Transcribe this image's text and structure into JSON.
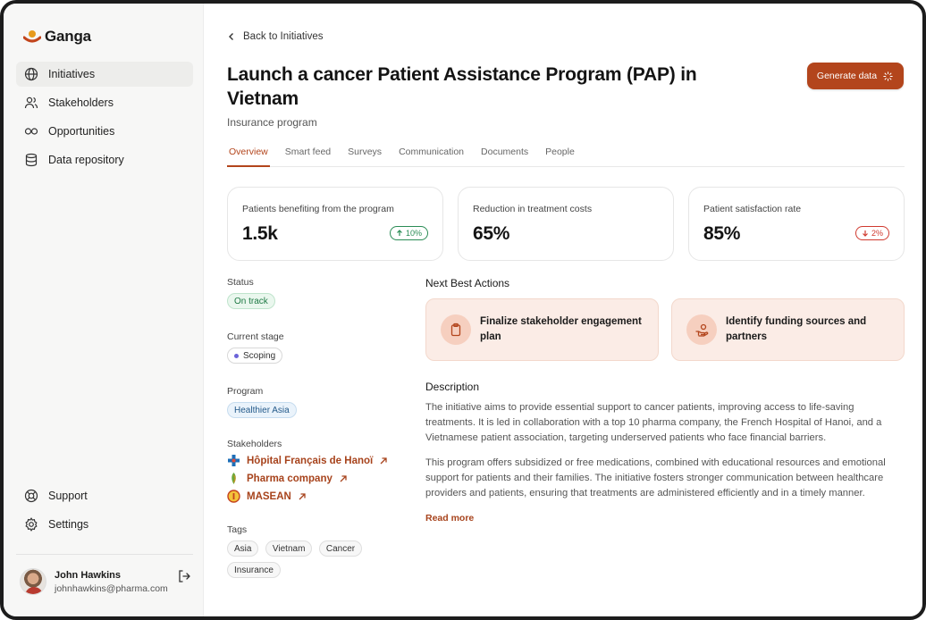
{
  "app": {
    "name": "Ganga",
    "accent": "#b3451c"
  },
  "sidebar": {
    "items": [
      {
        "label": "Initiatives",
        "icon": "globe-icon",
        "active": true
      },
      {
        "label": "Stakeholders",
        "icon": "users-icon"
      },
      {
        "label": "Opportunities",
        "icon": "infinity-icon"
      },
      {
        "label": "Data repository",
        "icon": "database-icon"
      }
    ],
    "bottom_items": [
      {
        "label": "Support",
        "icon": "lifebuoy-icon"
      },
      {
        "label": "Settings",
        "icon": "gear-icon"
      }
    ],
    "user": {
      "name": "John Hawkins",
      "email": "johnhawkins@pharma.com"
    }
  },
  "header": {
    "back_label": "Back to Initiatives",
    "title": "Launch a cancer Patient Assistance Program (PAP) in Vietnam",
    "subtitle": "Insurance program",
    "generate_label": "Generate data"
  },
  "tabs": [
    {
      "label": "Overview",
      "active": true
    },
    {
      "label": "Smart feed"
    },
    {
      "label": "Surveys"
    },
    {
      "label": "Communication"
    },
    {
      "label": "Documents"
    },
    {
      "label": "People"
    }
  ],
  "stats": [
    {
      "label": "Patients benefiting from the program",
      "value": "1.5k",
      "trend": "10%",
      "direction": "up"
    },
    {
      "label": "Reduction in treatment costs",
      "value": "65%"
    },
    {
      "label": "Patient satisfaction rate",
      "value": "85%",
      "trend": "2%",
      "direction": "down"
    }
  ],
  "meta": {
    "status_label": "Status",
    "status_value": "On track",
    "stage_label": "Current stage",
    "stage_value": "Scoping",
    "program_label": "Program",
    "program_value": "Healthier Asia",
    "stakeholders_label": "Stakeholders",
    "stakeholders": [
      {
        "name": "Hôpital Français de Hanoï"
      },
      {
        "name": "Pharma company"
      },
      {
        "name": "MASEAN"
      }
    ],
    "tags_label": "Tags",
    "tags": [
      "Asia",
      "Vietnam",
      "Cancer",
      "Insurance"
    ]
  },
  "next_best_actions": {
    "title": "Next Best Actions",
    "items": [
      {
        "label": "Finalize stakeholder engagement plan",
        "icon": "clipboard-icon"
      },
      {
        "label": "Identify funding sources and partners",
        "icon": "hand-coins-icon"
      }
    ]
  },
  "description": {
    "title": "Description",
    "paragraphs": [
      "The initiative aims to provide essential support to cancer patients, improving access to life-saving treatments. It is led in collaboration with a top 10 pharma company, the French Hospital of Hanoi, and a Vietnamese patient association, targeting underserved patients who face financial barriers.",
      "This program offers subsidized or free medications, combined with educational resources and emotional support for patients and their families. The initiative fosters stronger communication between healthcare providers and patients, ensuring that treatments are administered efficiently and in a timely manner."
    ],
    "read_more": "Read more"
  }
}
